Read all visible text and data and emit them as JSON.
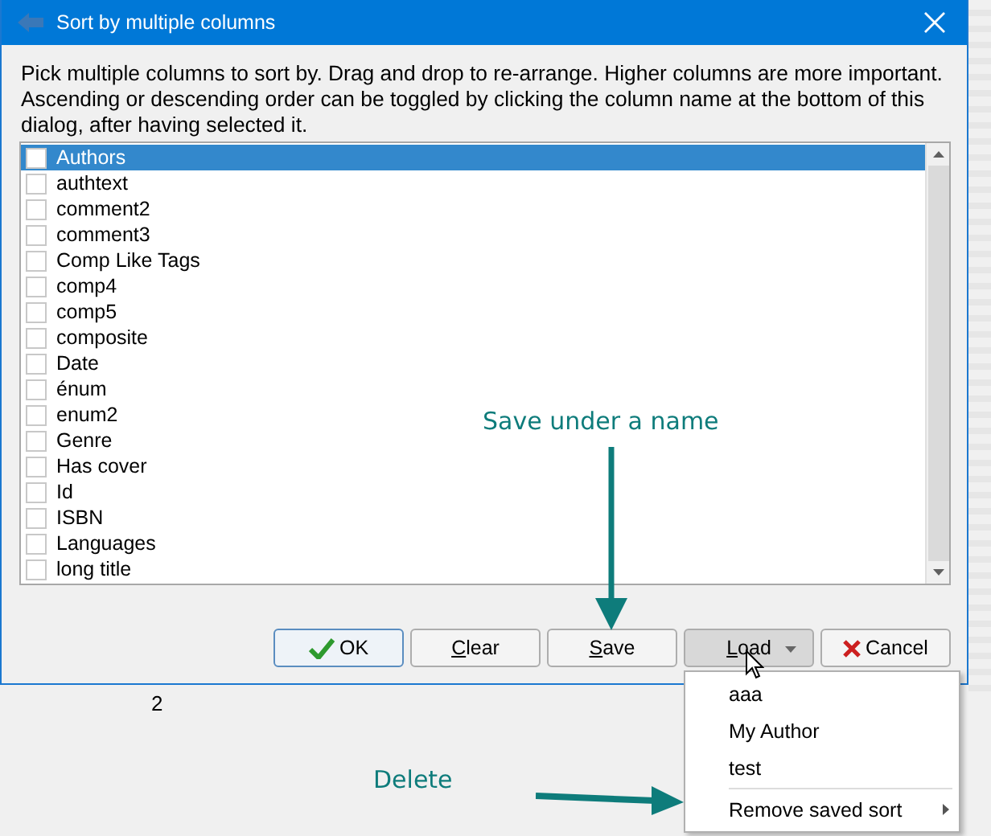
{
  "window": {
    "title": "Sort by multiple columns"
  },
  "description": "Pick multiple columns to sort by. Drag and drop to re-arrange. Higher columns are more important. Ascending or descending order can be toggled by clicking the column name at the bottom of this dialog, after having selected it.",
  "columns": [
    {
      "label": "Authors",
      "checked": false,
      "selected": true
    },
    {
      "label": "authtext",
      "checked": false,
      "selected": false
    },
    {
      "label": "comment2",
      "checked": false,
      "selected": false
    },
    {
      "label": "comment3",
      "checked": false,
      "selected": false
    },
    {
      "label": "Comp Like Tags",
      "checked": false,
      "selected": false
    },
    {
      "label": "comp4",
      "checked": false,
      "selected": false
    },
    {
      "label": "comp5",
      "checked": false,
      "selected": false
    },
    {
      "label": "composite",
      "checked": false,
      "selected": false
    },
    {
      "label": "Date",
      "checked": false,
      "selected": false
    },
    {
      "label": "énum",
      "checked": false,
      "selected": false
    },
    {
      "label": "enum2",
      "checked": false,
      "selected": false
    },
    {
      "label": "Genre",
      "checked": false,
      "selected": false
    },
    {
      "label": "Has cover",
      "checked": false,
      "selected": false
    },
    {
      "label": "Id",
      "checked": false,
      "selected": false
    },
    {
      "label": "ISBN",
      "checked": false,
      "selected": false
    },
    {
      "label": "Languages",
      "checked": false,
      "selected": false
    },
    {
      "label": "long title",
      "checked": false,
      "selected": false
    }
  ],
  "buttons": [
    {
      "label": "OK",
      "kind": "ok",
      "underline_first": false,
      "pressed": false,
      "dropdown": false
    },
    {
      "label": "Clear",
      "kind": "plain",
      "underline_first": true,
      "pressed": false,
      "dropdown": false
    },
    {
      "label": "Save",
      "kind": "plain",
      "underline_first": true,
      "pressed": false,
      "dropdown": false
    },
    {
      "label": "Load",
      "kind": "plain",
      "underline_first": true,
      "pressed": true,
      "dropdown": true
    },
    {
      "label": "Cancel",
      "kind": "cancel",
      "underline_first": false,
      "pressed": false,
      "dropdown": false
    }
  ],
  "background_text": "2",
  "menu": {
    "items": [
      {
        "label": "aaa",
        "submenu": false
      },
      {
        "label": "My Author",
        "submenu": false
      },
      {
        "label": "test",
        "submenu": false
      },
      {
        "label": "Remove saved sort",
        "submenu": true
      }
    ]
  },
  "annotations": {
    "save_hint": "Save under a name",
    "delete_hint": "Delete"
  }
}
